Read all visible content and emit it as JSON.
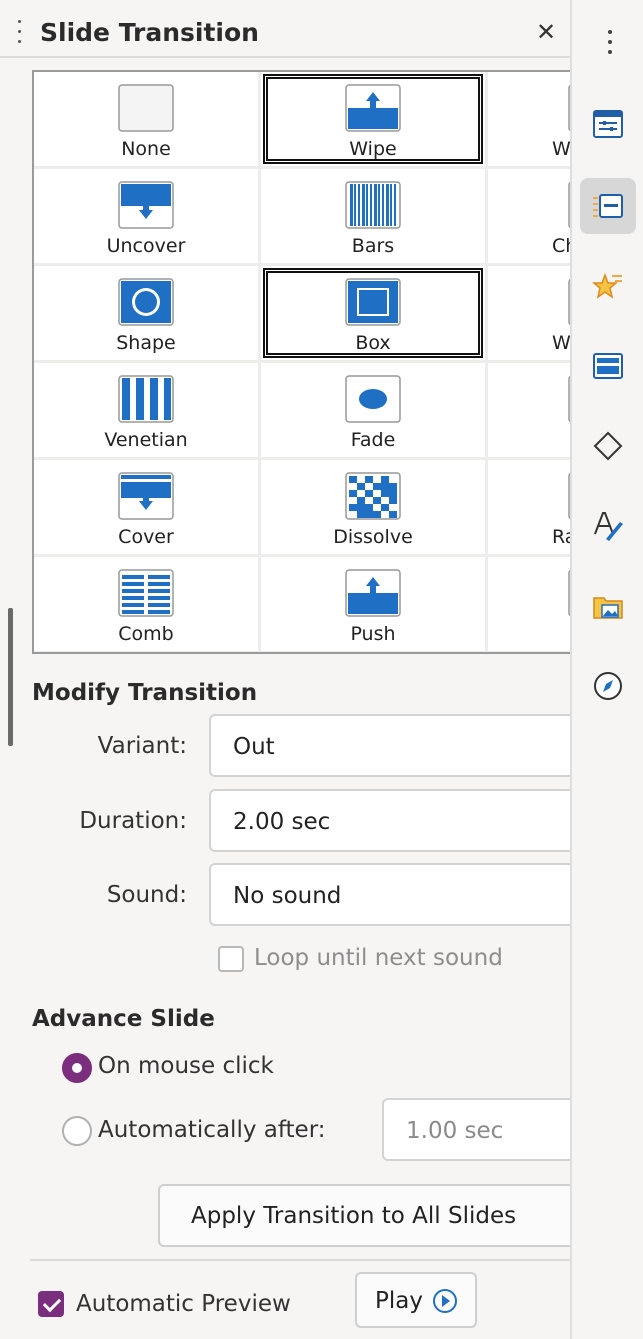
{
  "panel": {
    "title": "Slide Transition",
    "close_glyph": "✕"
  },
  "transitions": [
    {
      "label": "None",
      "icon": "none-transition-icon",
      "selected": false
    },
    {
      "label": "Wipe",
      "icon": "wipe-transition-icon",
      "selected": true
    },
    {
      "label": "W",
      "icon": "wheel-transition-icon",
      "selected": false
    },
    {
      "label": "Uncover",
      "icon": "uncover-transition-icon",
      "selected": false
    },
    {
      "label": "Bars",
      "icon": "bars-transition-icon",
      "selected": false
    },
    {
      "label": "Ch",
      "icon": "checkers-transition-icon",
      "selected": false
    },
    {
      "label": "Shape",
      "icon": "shape-transition-icon",
      "selected": false
    },
    {
      "label": "Box",
      "icon": "box-transition-icon",
      "selected": true
    },
    {
      "label": "W",
      "icon": "wedge-transition-icon",
      "selected": false
    },
    {
      "label": "Venetian",
      "icon": "venetian-transition-icon",
      "selected": false
    },
    {
      "label": "Fade",
      "icon": "fade-transition-icon",
      "selected": false
    },
    {
      "label": "",
      "icon": "cut-transition-icon",
      "selected": false
    },
    {
      "label": "Cover",
      "icon": "cover-transition-icon",
      "selected": false
    },
    {
      "label": "Dissolve",
      "icon": "dissolve-transition-icon",
      "selected": false
    },
    {
      "label": "Ra",
      "icon": "random-transition-icon",
      "selected": false
    },
    {
      "label": "Comb",
      "icon": "comb-transition-icon",
      "selected": false
    },
    {
      "label": "Push",
      "icon": "push-transition-icon",
      "selected": false
    },
    {
      "label": "",
      "icon": "zoom-transition-icon",
      "selected": false
    }
  ],
  "modify": {
    "heading": "Modify Transition",
    "variant_label": "Variant:",
    "variant_value": "Out",
    "duration_label": "Duration:",
    "duration_value": "2.00 sec",
    "sound_label": "Sound:",
    "sound_value": "No sound",
    "loop_label": "Loop until next sound",
    "loop_checked": false
  },
  "advance": {
    "heading": "Advance Slide",
    "mouse_click_label": "On mouse click",
    "mouse_click_selected": true,
    "auto_label": "Automatically after:",
    "auto_selected": false,
    "auto_value": "1.00 sec"
  },
  "apply_all_label": "Apply Transition to All Slides",
  "preview": {
    "auto_preview_label": "Automatic Preview",
    "auto_preview_checked": true,
    "play_label": "Play"
  },
  "colors": {
    "accent": "#7b2d7e",
    "icon_blue": "#1f6fc5"
  },
  "tabbar": {
    "tabs": [
      {
        "icon": "properties-icon",
        "active": false
      },
      {
        "icon": "slide-transition-icon",
        "active": true
      },
      {
        "icon": "animation-icon",
        "active": false
      },
      {
        "icon": "master-slides-icon",
        "active": false
      },
      {
        "icon": "shapes-icon",
        "active": false
      },
      {
        "icon": "styles-icon",
        "active": false
      },
      {
        "icon": "gallery-icon",
        "active": false
      },
      {
        "icon": "navigator-icon",
        "active": false
      }
    ]
  }
}
